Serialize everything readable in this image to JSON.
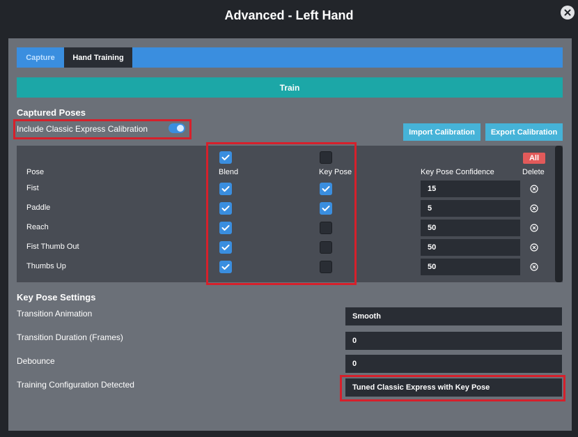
{
  "window": {
    "title": "Advanced - Left Hand"
  },
  "tabs": [
    {
      "label": "Capture",
      "active": false
    },
    {
      "label": "Hand Training",
      "active": true
    }
  ],
  "train_label": "Train",
  "captured": {
    "heading": "Captured Poses",
    "include_label": "Include Classic Express Calibration",
    "include_on": true,
    "import_label": "Import Calibration",
    "export_label": "Export Calibration"
  },
  "table": {
    "headers": {
      "pose": "Pose",
      "blend": "Blend",
      "keypose": "Key Pose",
      "confidence": "Key Pose Confidence",
      "delete": "Delete"
    },
    "all_label": "All",
    "header_blend_checked": true,
    "header_keypose_checked": false,
    "rows": [
      {
        "pose": "Fist",
        "blend": true,
        "keypose": true,
        "confidence": "15"
      },
      {
        "pose": "Paddle",
        "blend": true,
        "keypose": true,
        "confidence": "5"
      },
      {
        "pose": "Reach",
        "blend": true,
        "keypose": false,
        "confidence": "50"
      },
      {
        "pose": "Fist Thumb Out",
        "blend": true,
        "keypose": false,
        "confidence": "50"
      },
      {
        "pose": "Thumbs Up",
        "blend": true,
        "keypose": false,
        "confidence": "50"
      }
    ]
  },
  "settings": {
    "heading": "Key Pose Settings",
    "transition_animation": {
      "label": "Transition Animation",
      "value": "Smooth"
    },
    "transition_duration": {
      "label": "Transition Duration (Frames)",
      "value": "0"
    },
    "debounce": {
      "label": "Debounce",
      "value": "0"
    },
    "training_config": {
      "label": "Training Configuration Detected",
      "value": "Tuned Classic Express with Key Pose"
    }
  },
  "colors": {
    "accent_blue": "#3a8edf",
    "teal": "#1ca7a7",
    "highlight_red": "#d6202b",
    "danger": "#e25a5a"
  }
}
